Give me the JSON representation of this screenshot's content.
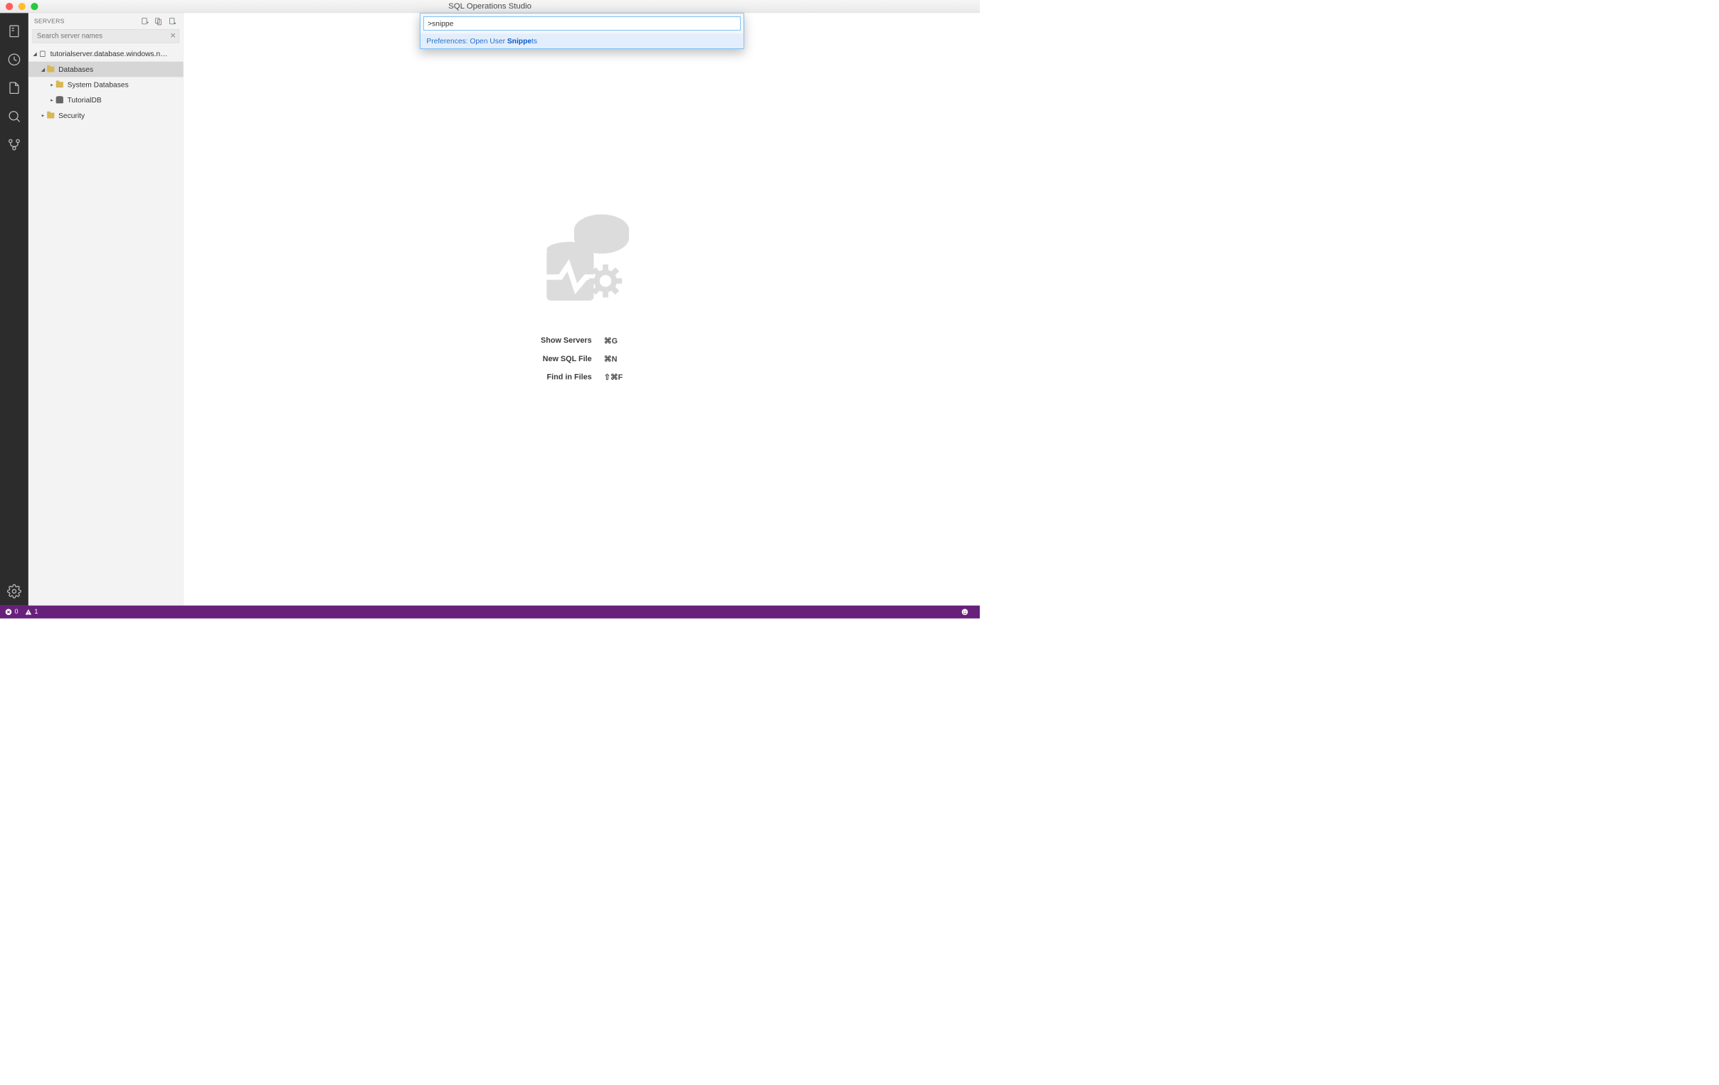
{
  "window": {
    "title": "SQL Operations Studio"
  },
  "activitybar": {
    "items": [
      {
        "name": "servers"
      },
      {
        "name": "task-history"
      },
      {
        "name": "explorer"
      },
      {
        "name": "search"
      },
      {
        "name": "source-control"
      }
    ],
    "bottom": {
      "name": "settings"
    }
  },
  "sidebar": {
    "title": "SERVERS",
    "header_icons": [
      "new-connection",
      "new-server-group",
      "show-active"
    ],
    "search": {
      "placeholder": "Search server names",
      "value": ""
    },
    "tree": {
      "server": {
        "label": "tutorialserver.database.windows.n…",
        "expanded": true
      },
      "databases_node": {
        "label": "Databases",
        "expanded": true,
        "selected": true
      },
      "system_databases": {
        "label": "System Databases",
        "expanded": false
      },
      "tutorial_db": {
        "label": "TutorialDB",
        "expanded": false
      },
      "security": {
        "label": "Security",
        "expanded": false
      }
    }
  },
  "palette": {
    "input_value": ">snippe",
    "result": {
      "prefix": "Preferences: Open User ",
      "match": "Snippe",
      "suffix": "ts"
    }
  },
  "welcome": {
    "commands": [
      {
        "label": "Show Servers",
        "shortcut": "⌘G"
      },
      {
        "label": "New SQL File",
        "shortcut": "⌘N"
      },
      {
        "label": "Find in Files",
        "shortcut": "⇧⌘F"
      }
    ]
  },
  "statusbar": {
    "errors": "0",
    "warnings": "1"
  }
}
